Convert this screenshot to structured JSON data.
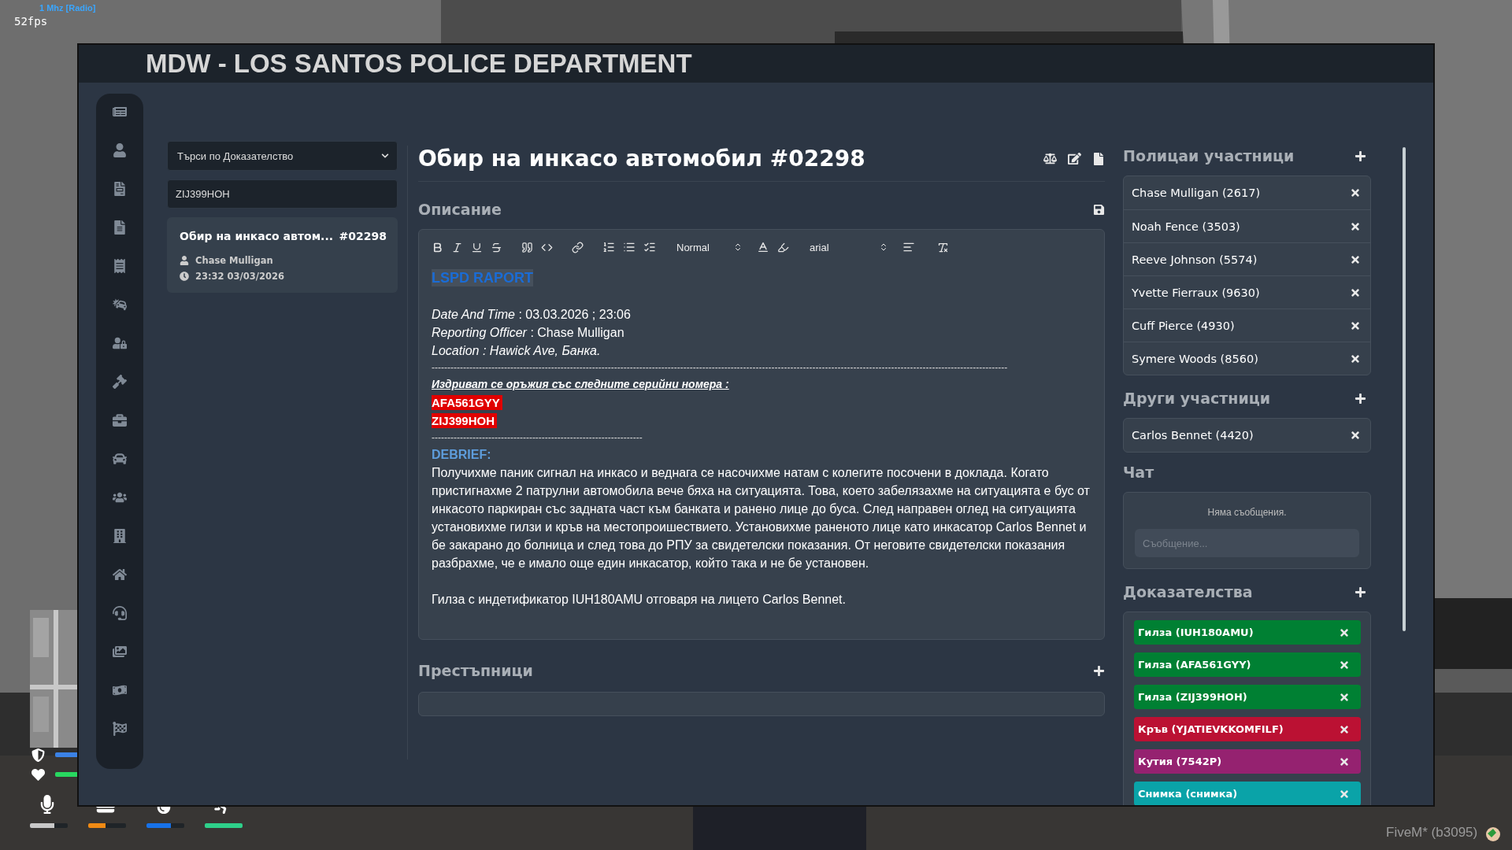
{
  "hud": {
    "radio": "1 Mhz [Radio]",
    "fps": "52fps",
    "build": "FiveM* (b3095)",
    "status": [
      {
        "kind": "armor",
        "level": 1
      },
      {
        "kind": "health",
        "level": 1
      }
    ],
    "meters": [
      {
        "kind": "voice",
        "level": 0.65
      },
      {
        "kind": "hunger",
        "level": 0.45
      },
      {
        "kind": "thirst",
        "level": 0.65
      },
      {
        "kind": "stamina",
        "level": 1
      }
    ]
  },
  "window": {
    "title": "MDW - LOS SANTOS POLICE DEPARTMENT"
  },
  "search": {
    "filter": "Търси по Доказателство",
    "value": "ZIJ399HOH"
  },
  "results": [
    {
      "title": "Обир на инкасо автом...",
      "number": "#02298",
      "officer": "Chase Mulligan",
      "time": "23:32 03/03/2026"
    }
  ],
  "report": {
    "title": "Обир на инкасо автомобил #02298",
    "description_label": "Описание",
    "toolbar": {
      "heading": "Normal",
      "font": "arial"
    },
    "content": [
      {
        "kind": "heading",
        "text": "LSPD RAPORT"
      },
      {
        "kind": "spacer"
      },
      {
        "kind": "line",
        "text": "*Date And Time* : 03.03.2026 ; 23:06"
      },
      {
        "kind": "line",
        "text": "*Reporting Officer* : Chase Mulligan"
      },
      {
        "kind": "italic",
        "text": "Location : Hawick Ave, Банка."
      },
      {
        "kind": "rule",
        "text": "---------------------------------------------------------------------------------------------------------------------------------------------------------------------------------------"
      },
      {
        "kind": "alert",
        "text": "Издриват се оръжия със следните серийни номера :"
      },
      {
        "kind": "marked",
        "text": "AFA561GYY"
      },
      {
        "kind": "marked",
        "text": "ZIJ399HOH"
      },
      {
        "kind": "rule",
        "text": "-------------------------------------------------------------------"
      },
      {
        "kind": "subheading",
        "text": "DEBRIEF:"
      },
      {
        "kind": "line",
        "text": "Получихме паник сигнал на инкасо и веднага се насочихме натам с колегите посочени в доклада. Когато пристигнахме 2 патрулни автомобила вече бяха на ситуацията. Това, което забелязахме на ситуацията е бус от инкасото паркиран със задната част към банката и ранено лице до буса. След направен оглед на ситуацията установихме гилзи и кръв на местопроишествието. Установихме раненото лице като инкасатор Carlos Bennet  и бе закарано до болница и след това до РПУ за свидетелски показания. От неговите свидетелски показания разбрахме, че е имало още един инкасатор, който така и не бе установен."
      },
      {
        "kind": "spacer"
      },
      {
        "kind": "line",
        "text": "Гилза с индетификатор IUH180AMU отговаря на лицето Carlos Bennet."
      }
    ],
    "criminals_label": "Престъпници"
  },
  "officers": {
    "label": "Полицаи участници",
    "items": [
      "Chase Mulligan (2617)",
      "Noah Fence (3503)",
      "Reeve Johnson (5574)",
      "Yvette Fierraux (9630)",
      "Cuff Pierce (4930)",
      "Symere Woods (8560)"
    ]
  },
  "others": {
    "label": "Други участници",
    "items": [
      "Carlos Bennet (4420)"
    ]
  },
  "chat": {
    "label": "Чат",
    "empty": "Няма съобщения.",
    "placeholder": "Съобщение..."
  },
  "evidence": {
    "label": "Доказателства",
    "items": [
      {
        "label": "Гилза (IUH180AMU)",
        "color": "#008033"
      },
      {
        "label": "Гилза (AFA561GYY)",
        "color": "#008033"
      },
      {
        "label": "Гилза (ZIJ399HOH)",
        "color": "#008033"
      },
      {
        "label": "Кръв (YJATIEVKKOMFILF)",
        "color": "#bb1133"
      },
      {
        "label": "Кутия (7542P)",
        "color": "#952270"
      },
      {
        "label": "Снимка (снимка)",
        "color": "#0aa3a8"
      }
    ]
  }
}
